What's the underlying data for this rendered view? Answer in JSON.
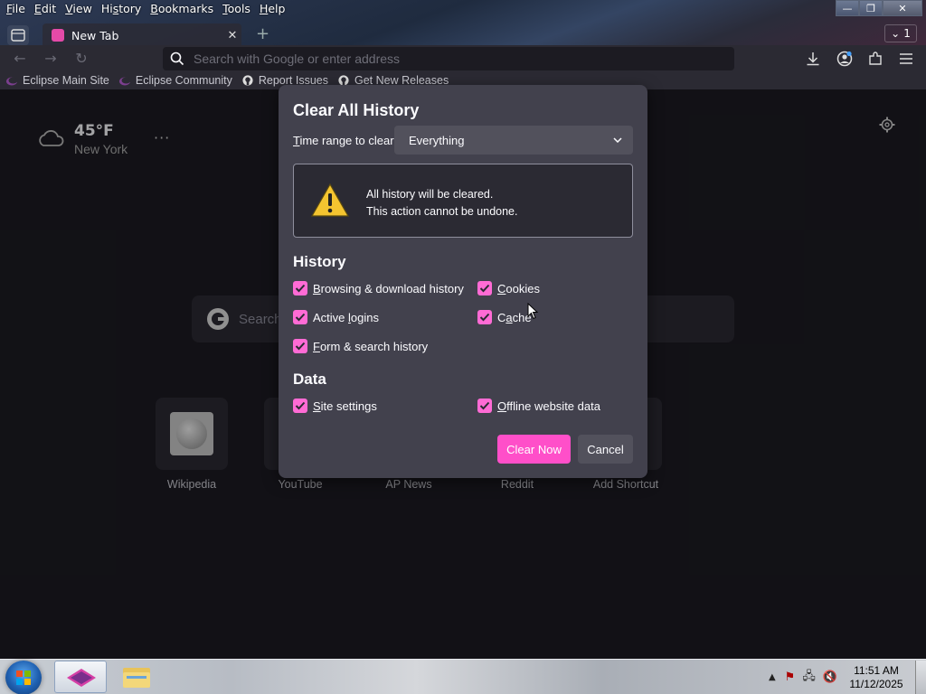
{
  "menubar": {
    "items": [
      "File",
      "Edit",
      "View",
      "History",
      "Bookmarks",
      "Tools",
      "Help"
    ]
  },
  "window_controls": {
    "minimize": "—",
    "maximize": "❐",
    "close": "✕"
  },
  "tabs": [
    {
      "label": "New Tab"
    }
  ],
  "tab_count": "1",
  "urlbar": {
    "placeholder": "Search with Google or enter address"
  },
  "bookmarks": [
    {
      "label": "Eclipse Main Site",
      "icon": "eclipse-icon"
    },
    {
      "label": "Eclipse Community",
      "icon": "eclipse-icon"
    },
    {
      "label": "Report Issues",
      "icon": "github-icon"
    },
    {
      "label": "Get New Releases",
      "icon": "github-icon"
    }
  ],
  "weather": {
    "temp": "45°F",
    "city": "New York",
    "more": "···"
  },
  "search": {
    "placeholder": "Search"
  },
  "shortcuts": [
    {
      "label": "Wikipedia"
    },
    {
      "label": "YouTube"
    },
    {
      "label": "AP News"
    },
    {
      "label": "Reddit"
    },
    {
      "label": "Add Shortcut"
    }
  ],
  "dialog": {
    "title": "Clear All History",
    "time_range_label_pre": "",
    "time_range_label_u": "T",
    "time_range_label_post": "ime range to clear:",
    "time_range_value": "Everything",
    "warning_line1": "All history will be cleared.",
    "warning_line2": "This action cannot be undone.",
    "history_heading": "History",
    "data_heading": "Data",
    "options": {
      "browsing": {
        "u": "B",
        "rest": "rowsing & download history",
        "checked": true
      },
      "logins": {
        "u": "",
        "pre": "Active ",
        "ul": "l",
        "rest": "ogins",
        "checked": true
      },
      "form": {
        "u": "F",
        "rest": "orm & search history",
        "checked": true
      },
      "cookies": {
        "u": "C",
        "rest": "ookies",
        "checked": true
      },
      "cache": {
        "pre": "C",
        "ul": "a",
        "rest": "che",
        "checked": true
      },
      "site_settings": {
        "u": "S",
        "rest": "ite settings",
        "checked": true
      },
      "offline": {
        "u": "O",
        "rest": "ffline website data",
        "checked": true
      }
    },
    "clear_button": "Clear Now",
    "cancel_button": "Cancel"
  },
  "taskbar": {
    "time": "11:51 AM",
    "date": "11/12/2025"
  },
  "colors": {
    "accent": "#ff4fc9",
    "checkbox": "#ff6bd5",
    "dialog_bg": "#42414d",
    "page_bg": "#1c1b22"
  }
}
